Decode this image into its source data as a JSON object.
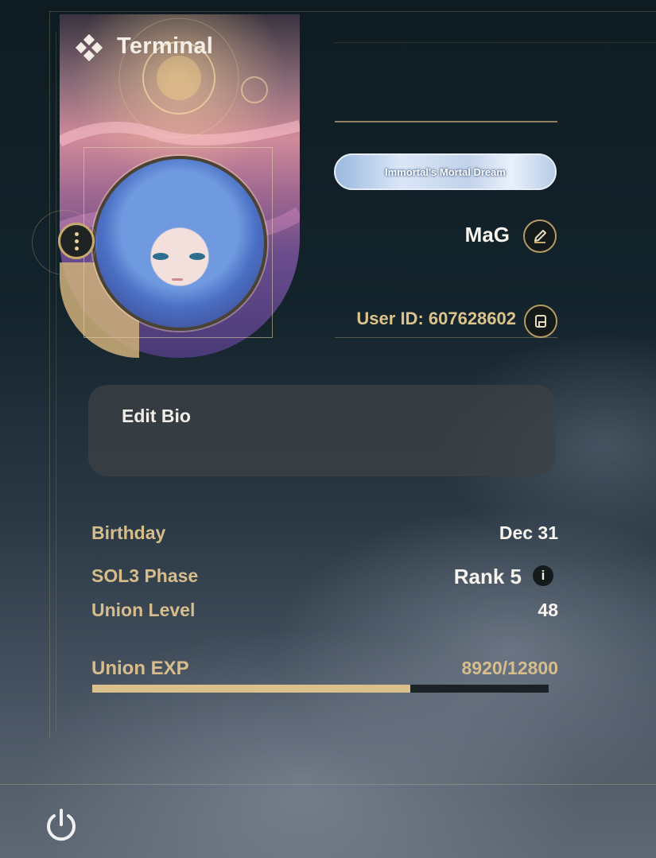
{
  "header": {
    "title": "Terminal",
    "icon": "diamond-cluster-icon"
  },
  "profile": {
    "title_badge": "Immortal's Mortal Dream",
    "username": "MaG",
    "user_id": "User ID: 607628602",
    "edit_icon": "pencil-icon",
    "copy_icon": "copy-icon",
    "menu_icon": "more-vertical-icon"
  },
  "bio": {
    "label": "Edit Bio"
  },
  "stats": {
    "birthday": {
      "label": "Birthday",
      "value": "Dec 31"
    },
    "sol3": {
      "label": "SOL3 Phase",
      "value": "Rank 5",
      "info_icon": "info-icon"
    },
    "union_level": {
      "label": "Union Level",
      "value": "48"
    },
    "union_exp": {
      "label": "Union EXP",
      "value": "8920/12800",
      "current": 8920,
      "max": 12800
    }
  },
  "footer": {
    "power_icon": "power-icon"
  },
  "colors": {
    "gold": "#d6bd8b",
    "accent": "#c9aa6e",
    "text": "#f7f4ee"
  }
}
